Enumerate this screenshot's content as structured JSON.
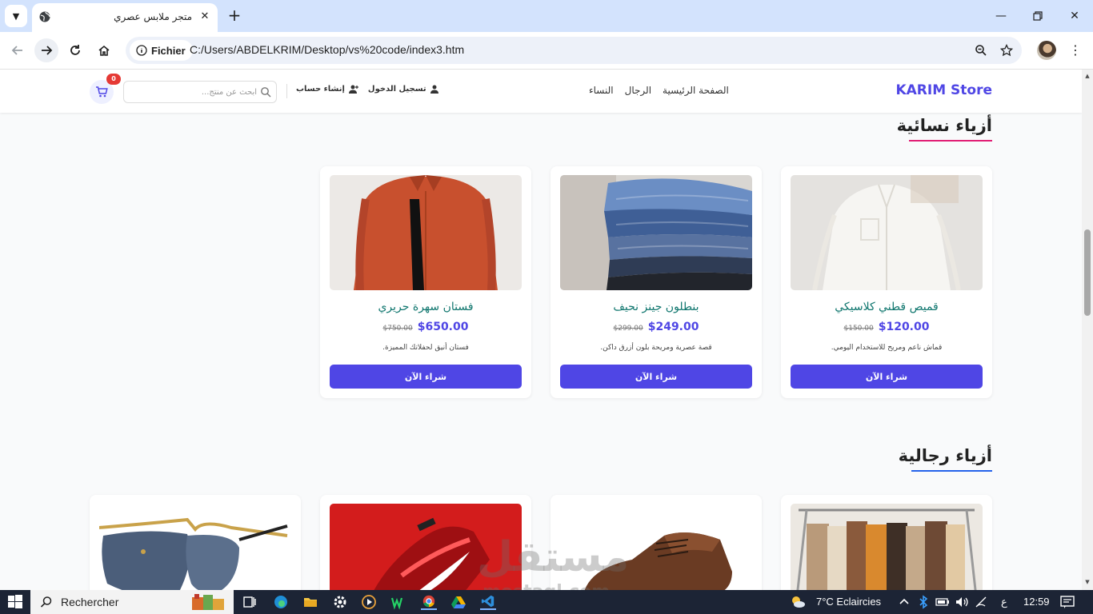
{
  "browser": {
    "tab_title": "متجر ملابس عصري",
    "site_chip_label": "Fichier",
    "url": "C:/Users/ABDELKRIM/Desktop/vs%20code/index3.htm",
    "icons": [
      "tab-search-menu-icon",
      "globe-icon",
      "close-icon",
      "plus-icon",
      "minimize-icon",
      "restore-icon",
      "back-icon",
      "forward-icon",
      "reload-icon",
      "home-icon",
      "info-icon",
      "zoom-icon",
      "star-icon",
      "kebab-menu-icon"
    ]
  },
  "site": {
    "brand": "KARIM Store",
    "nav": [
      "الصفحة الرئيسية",
      "الرجال",
      "النساء"
    ],
    "login_label": "تسجيل الدخول",
    "signup_label": "إنشاء حساب",
    "search_placeholder": "ابحث عن منتج...",
    "cart_count": "0",
    "accent_color": "#4f46e5",
    "women_section": {
      "title": "أزياء نسائية",
      "underline_color": "#e11d74",
      "products": [
        {
          "name": "قميص قطني كلاسيكي",
          "old_price": "$150.00",
          "price": "$120.00",
          "description": "قماش ناعم ومريح للاستخدام اليومي.",
          "buy_label": "شراء الآن"
        },
        {
          "name": "بنطلون جينز نحيف",
          "old_price": "$299.00",
          "price": "$249.00",
          "description": "قصة عصرية ومريحة بلون أزرق داكن.",
          "buy_label": "شراء الآن"
        },
        {
          "name": "فستان سهرة حريري",
          "old_price": "$750.00",
          "price": "$650.00",
          "description": "فستان أنيق لحفلاتك المميزة.",
          "buy_label": "شراء الآن"
        }
      ]
    },
    "men_section": {
      "title": "أزياء رجالية",
      "underline_color": "#2563eb"
    },
    "watermark": {
      "arabic": "مستقل",
      "latin": "mostaql.com"
    }
  },
  "taskbar": {
    "search_placeholder": "Rechercher",
    "weather": "7°C  Eclaircies",
    "ime": "ع",
    "clock": "12:59"
  }
}
